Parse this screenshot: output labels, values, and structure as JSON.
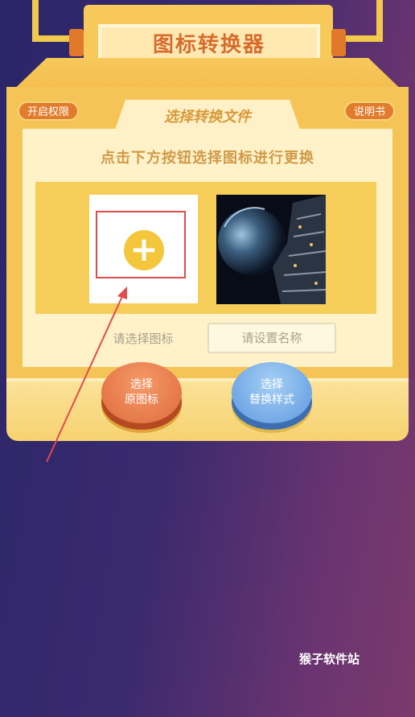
{
  "header": {
    "title": "图标转换器"
  },
  "machine": {
    "permission_button": "开启权限",
    "help_button": "说明书",
    "tab_label": "选择转换文件",
    "instruction": "点击下方按钮选择图标进行更换",
    "select_icon_label": "请选择图标",
    "name_placeholder": "请设置名称",
    "btn_original_line1": "选择",
    "btn_original_line2": "原图标",
    "btn_style_line1": "选择",
    "btn_style_line2": "替换样式"
  },
  "watermark": "猴子软件站",
  "colors": {
    "accent_orange": "#e17c2c",
    "machine_yellow": "#f4c556",
    "highlight_red": "#e24b4b"
  }
}
